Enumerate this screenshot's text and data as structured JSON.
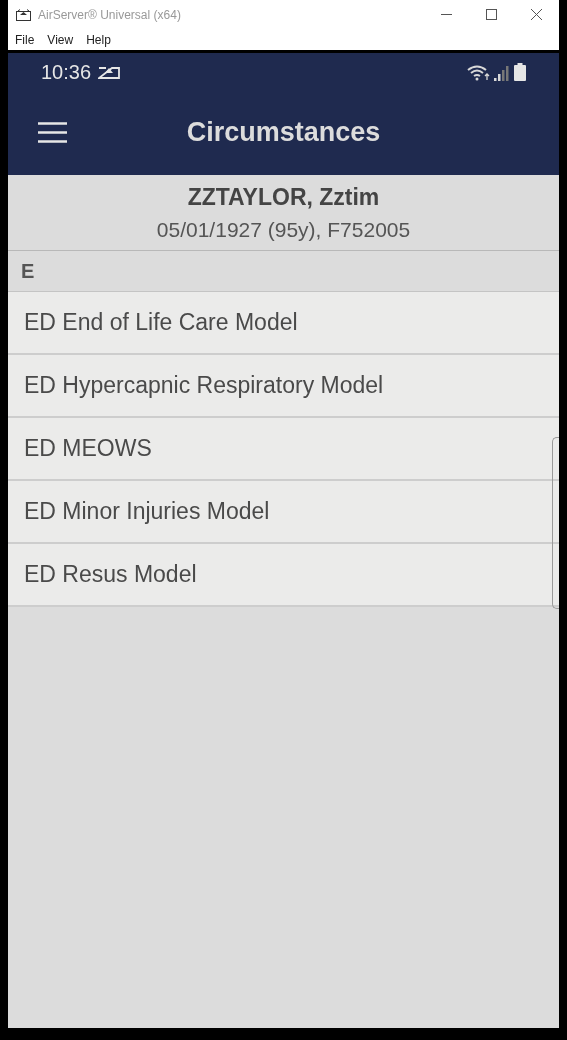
{
  "window": {
    "title": "AirServer® Universal (x64)"
  },
  "menu": [
    "File",
    "View",
    "Help"
  ],
  "status_bar": {
    "time": "10:36"
  },
  "app_bar": {
    "title": "Circumstances"
  },
  "patient": {
    "name": "ZZTAYLOR, Zztim",
    "details": "05/01/1927 (95y), F752005"
  },
  "section": {
    "header": "E",
    "items": [
      {
        "label": "ED End of Life Care Model"
      },
      {
        "label": "ED Hypercapnic Respiratory Model"
      },
      {
        "label": "ED MEOWS"
      },
      {
        "label": "ED Minor Injuries Model"
      },
      {
        "label": "ED Resus Model"
      }
    ]
  }
}
